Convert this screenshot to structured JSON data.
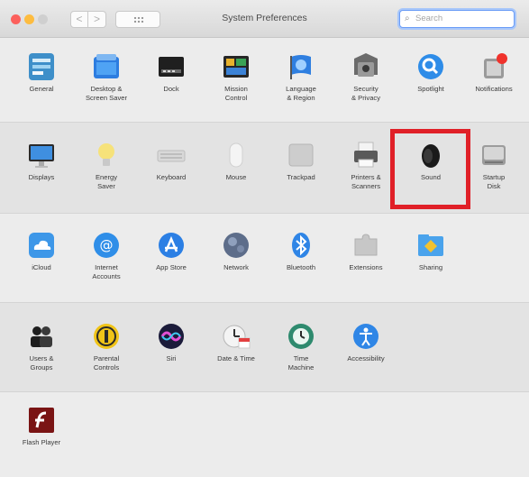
{
  "window": {
    "title": "System Preferences",
    "search_placeholder": "Search",
    "back_label": "<",
    "forward_label": ">"
  },
  "rows": [
    {
      "panes": [
        {
          "label": "General",
          "icon": "general-icon"
        },
        {
          "label": "Desktop &\nScreen Saver",
          "icon": "desktop-screen-saver-icon"
        },
        {
          "label": "Dock",
          "icon": "dock-icon"
        },
        {
          "label": "Mission\nControl",
          "icon": "mission-control-icon"
        },
        {
          "label": "Language\n& Region",
          "icon": "language-region-icon"
        },
        {
          "label": "Security\n& Privacy",
          "icon": "security-privacy-icon"
        },
        {
          "label": "Spotlight",
          "icon": "spotlight-icon"
        },
        {
          "label": "Notifications",
          "icon": "notifications-icon"
        }
      ]
    },
    {
      "panes": [
        {
          "label": "Displays",
          "icon": "displays-icon"
        },
        {
          "label": "Energy\nSaver",
          "icon": "energy-saver-icon"
        },
        {
          "label": "Keyboard",
          "icon": "keyboard-icon"
        },
        {
          "label": "Mouse",
          "icon": "mouse-icon"
        },
        {
          "label": "Trackpad",
          "icon": "trackpad-icon"
        },
        {
          "label": "Printers &\nScanners",
          "icon": "printers-scanners-icon"
        },
        {
          "label": "Sound",
          "icon": "sound-icon"
        },
        {
          "label": "Startup\nDisk",
          "icon": "startup-disk-icon"
        }
      ]
    },
    {
      "panes": [
        {
          "label": "iCloud",
          "icon": "icloud-icon"
        },
        {
          "label": "Internet\nAccounts",
          "icon": "internet-accounts-icon"
        },
        {
          "label": "App Store",
          "icon": "app-store-icon"
        },
        {
          "label": "Network",
          "icon": "network-icon"
        },
        {
          "label": "Bluetooth",
          "icon": "bluetooth-icon"
        },
        {
          "label": "Extensions",
          "icon": "extensions-icon"
        },
        {
          "label": "Sharing",
          "icon": "sharing-icon"
        }
      ]
    },
    {
      "panes": [
        {
          "label": "Users &\nGroups",
          "icon": "users-groups-icon"
        },
        {
          "label": "Parental\nControls",
          "icon": "parental-controls-icon"
        },
        {
          "label": "Siri",
          "icon": "siri-icon"
        },
        {
          "label": "Date & Time",
          "icon": "date-time-icon"
        },
        {
          "label": "Time\nMachine",
          "icon": "time-machine-icon"
        },
        {
          "label": "Accessibility",
          "icon": "accessibility-icon"
        }
      ]
    },
    {
      "panes": [
        {
          "label": "Flash Player",
          "icon": "flash-player-icon"
        }
      ]
    }
  ],
  "highlight": {
    "pane": "Sound",
    "color": "#e02028"
  }
}
